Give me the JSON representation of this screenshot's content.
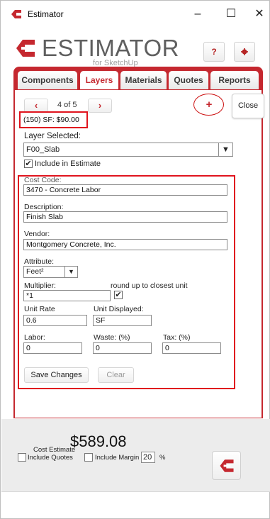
{
  "window": {
    "title": "Estimator",
    "controls": {
      "minimize": "–",
      "maximize": "☐",
      "close": "✕"
    }
  },
  "header": {
    "logo_main": "ESTIMATOR",
    "logo_sub": "for SketchUp",
    "help_label": "?",
    "settings_icon": "gear-icon",
    "brand_color": "#c5282f"
  },
  "tabs": [
    {
      "label": "Components",
      "active": false
    },
    {
      "label": "Layers",
      "active": true
    },
    {
      "label": "Materials",
      "active": false
    },
    {
      "label": "Quotes",
      "active": false
    },
    {
      "label": "Reports",
      "active": false
    }
  ],
  "pager": {
    "prev_label": "‹",
    "indicator": "4 of 5",
    "next_label": "›",
    "add_label": "+",
    "close_label": "Close"
  },
  "summary": "(150) SF: $90.00",
  "layer": {
    "label": "Layer Selected:",
    "selected": "F00_Slab",
    "include_label": "Include in Estimate",
    "include_checked": "✔"
  },
  "form": {
    "cost_code_label": "Cost Code:",
    "cost_code_value": "3470 - Concrete Labor",
    "description_label": "Description:",
    "description_value": "Finish Slab",
    "vendor_label": "Vendor:",
    "vendor_value": "Montgomery Concrete, Inc.",
    "attribute_label": "Attribute:",
    "attribute_value": "Feet²",
    "multiplier_label": "Multiplier:",
    "multiplier_value": "*1",
    "round_label": "round up to closest unit",
    "round_checked": "✔",
    "unit_rate_label": "Unit Rate",
    "unit_rate_value": "0.6",
    "unit_displayed_label": "Unit Displayed:",
    "unit_displayed_value": "SF",
    "labor_label": "Labor:",
    "labor_value": "0",
    "waste_label": "Waste: (%)",
    "waste_value": "0",
    "tax_label": "Tax: (%)",
    "tax_value": "0",
    "save_label": "Save Changes",
    "clear_label": "Clear"
  },
  "footer": {
    "cost_estimate_label": "Cost Estimate",
    "cost_estimate_value": "$589.08",
    "include_quotes_label": "Include Quotes",
    "include_margin_label": "Include Margin",
    "margin_value": "20",
    "percent_label": "%"
  }
}
